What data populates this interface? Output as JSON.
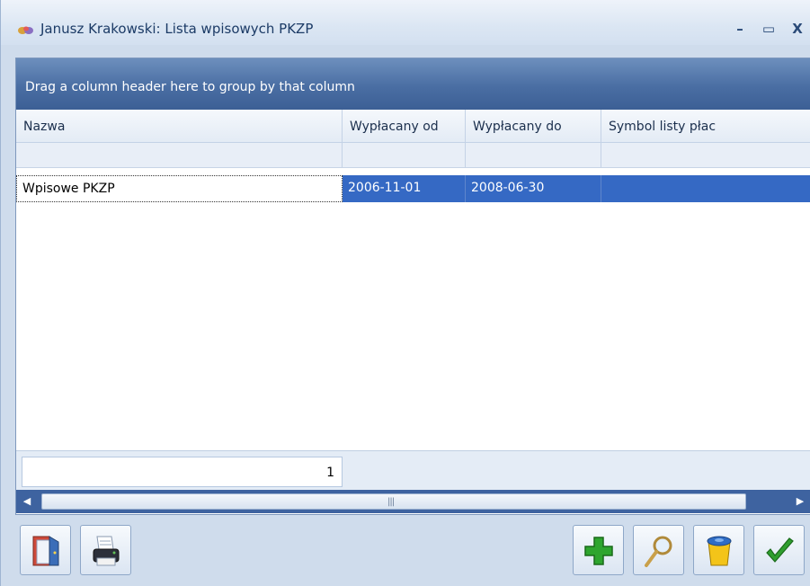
{
  "window": {
    "title": "Janusz Krakowski: Lista wpisowych PKZP",
    "minimize_label": "–",
    "maximize_label": "▭",
    "close_label": "X"
  },
  "grid": {
    "group_panel_text": "Drag a column header here to group by that column",
    "columns": [
      "Nazwa",
      "Wypłacany od",
      "Wypłacany do",
      "Symbol listy płac"
    ],
    "rows": [
      {
        "nazwa": "Wpisowe PKZP",
        "od": "2006-11-01",
        "do": "2008-06-30",
        "symbol": ""
      }
    ],
    "summary_count": "1"
  },
  "toolbar": {
    "icons": [
      "exit-door-icon",
      "printer-icon",
      "add-plus-icon",
      "magnifier-icon",
      "trash-bin-icon",
      "checkmark-icon"
    ]
  },
  "colors": {
    "selection": "#3569c4",
    "group_panel": "#4a6ea3",
    "add_green": "#2ea52e",
    "ok_green": "#2f9e2f"
  }
}
